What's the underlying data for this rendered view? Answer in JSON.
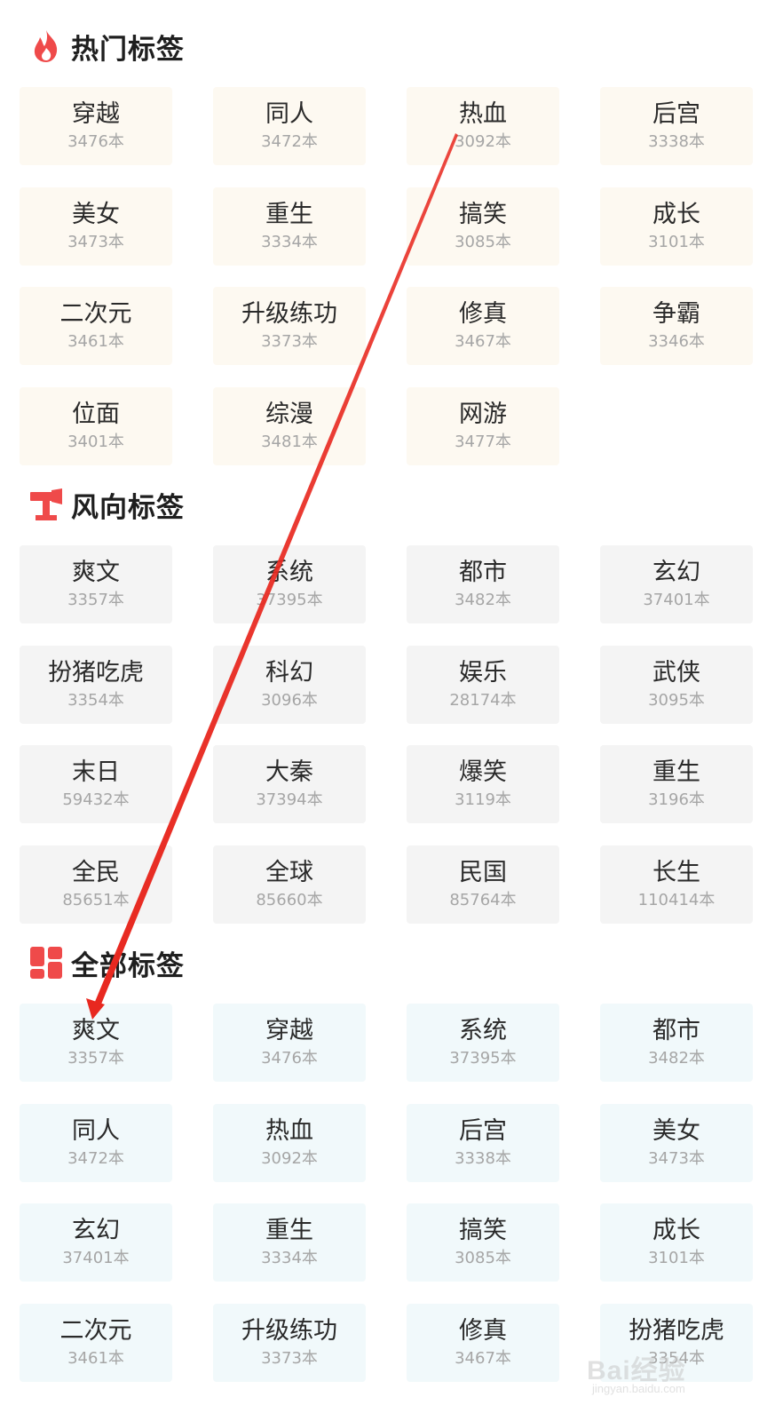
{
  "sections": {
    "hot": {
      "title": "热门标签",
      "tags": [
        {
          "name": "穿越",
          "count": "3476本"
        },
        {
          "name": "同人",
          "count": "3472本"
        },
        {
          "name": "热血",
          "count": "3092本"
        },
        {
          "name": "后宫",
          "count": "3338本"
        },
        {
          "name": "美女",
          "count": "3473本"
        },
        {
          "name": "重生",
          "count": "3334本"
        },
        {
          "name": "搞笑",
          "count": "3085本"
        },
        {
          "name": "成长",
          "count": "3101本"
        },
        {
          "name": "二次元",
          "count": "3461本"
        },
        {
          "name": "升级练功",
          "count": "3373本"
        },
        {
          "name": "修真",
          "count": "3467本"
        },
        {
          "name": "争霸",
          "count": "3346本"
        },
        {
          "name": "位面",
          "count": "3401本"
        },
        {
          "name": "综漫",
          "count": "3481本"
        },
        {
          "name": "网游",
          "count": "3477本"
        }
      ]
    },
    "trend": {
      "title": "风向标签",
      "tags": [
        {
          "name": "爽文",
          "count": "3357本"
        },
        {
          "name": "系统",
          "count": "37395本"
        },
        {
          "name": "都市",
          "count": "3482本"
        },
        {
          "name": "玄幻",
          "count": "37401本"
        },
        {
          "name": "扮猪吃虎",
          "count": "3354本"
        },
        {
          "name": "科幻",
          "count": "3096本"
        },
        {
          "name": "娱乐",
          "count": "28174本"
        },
        {
          "name": "武侠",
          "count": "3095本"
        },
        {
          "name": "末日",
          "count": "59432本"
        },
        {
          "name": "大秦",
          "count": "37394本"
        },
        {
          "name": "爆笑",
          "count": "3119本"
        },
        {
          "name": "重生",
          "count": "3196本"
        },
        {
          "name": "全民",
          "count": "85651本"
        },
        {
          "name": "全球",
          "count": "85660本"
        },
        {
          "name": "民国",
          "count": "85764本"
        },
        {
          "name": "长生",
          "count": "110414本"
        }
      ]
    },
    "all": {
      "title": "全部标签",
      "tags": [
        {
          "name": "爽文",
          "count": "3357本"
        },
        {
          "name": "穿越",
          "count": "3476本"
        },
        {
          "name": "系统",
          "count": "37395本"
        },
        {
          "name": "都市",
          "count": "3482本"
        },
        {
          "name": "同人",
          "count": "3472本"
        },
        {
          "name": "热血",
          "count": "3092本"
        },
        {
          "name": "后宫",
          "count": "3338本"
        },
        {
          "name": "美女",
          "count": "3473本"
        },
        {
          "name": "玄幻",
          "count": "37401本"
        },
        {
          "name": "重生",
          "count": "3334本"
        },
        {
          "name": "搞笑",
          "count": "3085本"
        },
        {
          "name": "成长",
          "count": "3101本"
        },
        {
          "name": "二次元",
          "count": "3461本"
        },
        {
          "name": "升级练功",
          "count": "3373本"
        },
        {
          "name": "修真",
          "count": "3467本"
        },
        {
          "name": "扮猪吃虎",
          "count": "3354本"
        }
      ]
    }
  },
  "icons": {
    "hot": "fire-icon",
    "trend": "weather-vane-icon",
    "all": "grid-icon"
  },
  "colors": {
    "accent": "#ef4a4a",
    "arrow": "#e8281f",
    "hot_tile": "#fdf9f1",
    "trend_tile": "#f4f4f4",
    "all_tile": "#f1f9fb"
  },
  "watermark": {
    "brand": "Bai经验",
    "url": "jingyan.baidu.com"
  }
}
